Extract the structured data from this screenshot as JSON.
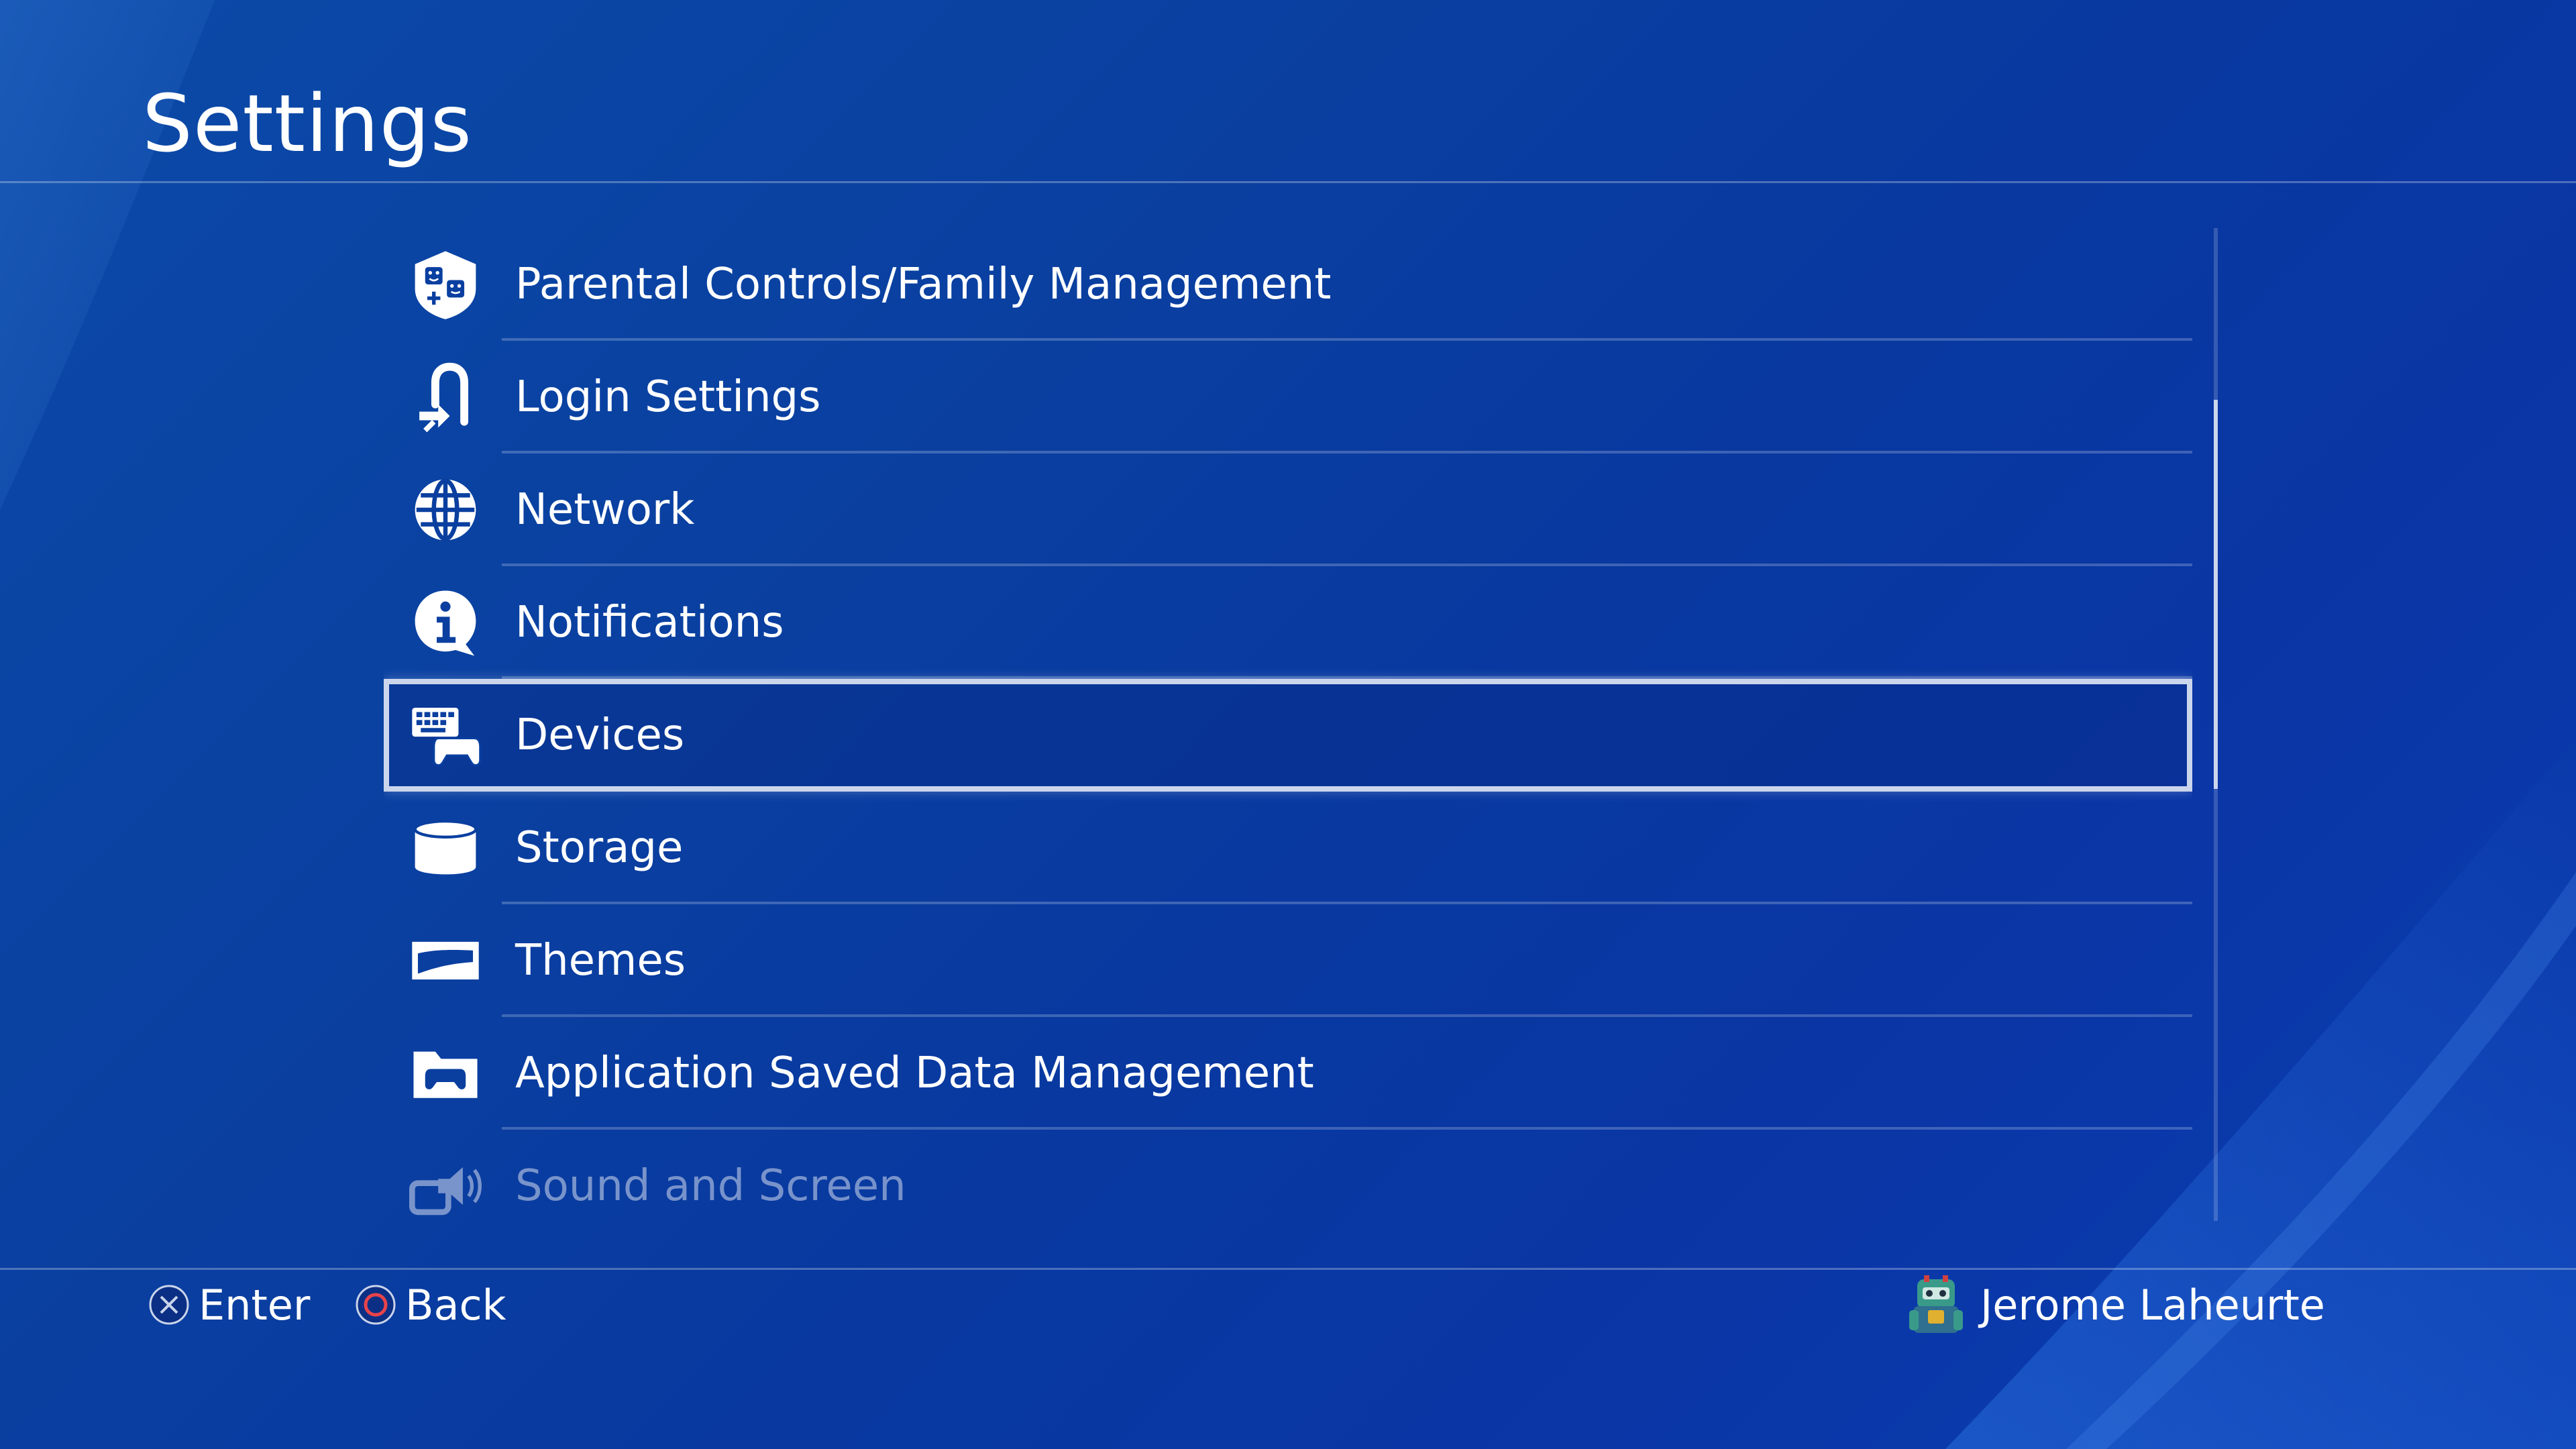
{
  "header": {
    "title": "Settings"
  },
  "settings": {
    "items": [
      {
        "label": "Parental Controls/Family Management",
        "icon": "parental-controls-icon"
      },
      {
        "label": "Login Settings",
        "icon": "login-icon"
      },
      {
        "label": "Network",
        "icon": "globe-icon"
      },
      {
        "label": "Notifications",
        "icon": "info-bubble-icon"
      },
      {
        "label": "Devices",
        "icon": "devices-icon",
        "selected": true
      },
      {
        "label": "Storage",
        "icon": "storage-icon"
      },
      {
        "label": "Themes",
        "icon": "themes-icon"
      },
      {
        "label": "Application Saved Data Management",
        "icon": "saved-data-icon"
      },
      {
        "label": "Sound and Screen",
        "icon": "sound-screen-icon"
      }
    ]
  },
  "footer": {
    "enter_label": "Enter",
    "back_label": "Back",
    "user_name": "Jerome Laheurte"
  },
  "colors": {
    "background": "#0a3fa0",
    "text": "#ffffff",
    "back_button": "#e8434b"
  }
}
